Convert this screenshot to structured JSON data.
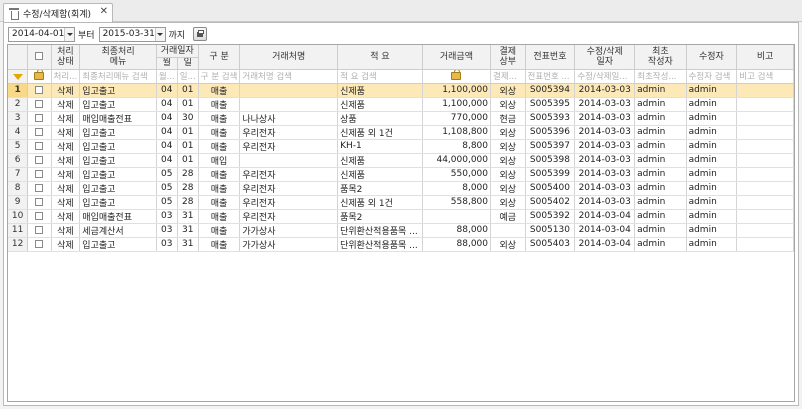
{
  "tab": {
    "title": "수정/삭제함(회계)",
    "close": "✕"
  },
  "toolbar": {
    "from_date": "2014-04-01",
    "from_label": "부터",
    "to_date": "2015-03-31",
    "to_label": "까지"
  },
  "headers": {
    "status": "처리\n상태",
    "menu": "최종처리\n메뉴",
    "trade_date": "거래일자",
    "month": "월",
    "day": "일",
    "category": "구 분",
    "customer": "거래처명",
    "summary": "적 요",
    "amount": "거래금액",
    "payment": "결제\n상부",
    "voucher": "전표번호",
    "modified_date": "수정/삭제\n일자",
    "creator": "최초\n작성자",
    "modifier": "수정자",
    "note": "비고"
  },
  "filters": {
    "status": "처리...",
    "menu": "최종처리메뉴 검색",
    "month": "월...",
    "day": "일...",
    "category": "구 분 검색",
    "customer": "거래처명 검색",
    "summary": "적 요 검색",
    "payment": "결제...",
    "voucher": "전표번호 ...",
    "modified_date": "수정/삭제일...",
    "creator": "최초작성...",
    "modifier": "수정자 검색",
    "note": "비고 검색"
  },
  "rows": [
    {
      "no": "1",
      "status": "삭제",
      "menu": "입고출고",
      "month": "04",
      "day": "01",
      "category": "매출",
      "customer": "",
      "summary": "신제품",
      "amount": "1,100,000",
      "payment": "외상",
      "voucher": "S005394",
      "modified": "2014-03-03",
      "creator": "admin",
      "modifier": "admin",
      "note": ""
    },
    {
      "no": "2",
      "status": "삭제",
      "menu": "입고출고",
      "month": "04",
      "day": "01",
      "category": "매출",
      "customer": "",
      "summary": "신제품",
      "amount": "1,100,000",
      "payment": "외상",
      "voucher": "S005395",
      "modified": "2014-03-03",
      "creator": "admin",
      "modifier": "admin",
      "note": ""
    },
    {
      "no": "3",
      "status": "삭제",
      "menu": "매입매출전표",
      "month": "04",
      "day": "30",
      "category": "매출",
      "customer": "나나상사",
      "summary": "상품",
      "amount": "770,000",
      "payment": "현금",
      "voucher": "S005393",
      "modified": "2014-03-03",
      "creator": "admin",
      "modifier": "admin",
      "note": ""
    },
    {
      "no": "4",
      "status": "삭제",
      "menu": "입고출고",
      "month": "04",
      "day": "01",
      "category": "매출",
      "customer": "우리전자",
      "summary": "신제품 외 1건",
      "amount": "1,108,800",
      "payment": "외상",
      "voucher": "S005396",
      "modified": "2014-03-03",
      "creator": "admin",
      "modifier": "admin",
      "note": ""
    },
    {
      "no": "5",
      "status": "삭제",
      "menu": "입고출고",
      "month": "04",
      "day": "01",
      "category": "매출",
      "customer": "우리전자",
      "summary": "KH-1",
      "amount": "8,800",
      "payment": "외상",
      "voucher": "S005397",
      "modified": "2014-03-03",
      "creator": "admin",
      "modifier": "admin",
      "note": ""
    },
    {
      "no": "6",
      "status": "삭제",
      "menu": "입고출고",
      "month": "04",
      "day": "01",
      "category": "매입",
      "customer": "",
      "summary": "신제품",
      "amount": "44,000,000",
      "payment": "외상",
      "voucher": "S005398",
      "modified": "2014-03-03",
      "creator": "admin",
      "modifier": "admin",
      "note": ""
    },
    {
      "no": "7",
      "status": "삭제",
      "menu": "입고출고",
      "month": "05",
      "day": "28",
      "category": "매출",
      "customer": "우리전자",
      "summary": "신제품",
      "amount": "550,000",
      "payment": "외상",
      "voucher": "S005399",
      "modified": "2014-03-03",
      "creator": "admin",
      "modifier": "admin",
      "note": ""
    },
    {
      "no": "8",
      "status": "삭제",
      "menu": "입고출고",
      "month": "05",
      "day": "28",
      "category": "매출",
      "customer": "우리전자",
      "summary": "품목2",
      "amount": "8,000",
      "payment": "외상",
      "voucher": "S005400",
      "modified": "2014-03-03",
      "creator": "admin",
      "modifier": "admin",
      "note": ""
    },
    {
      "no": "9",
      "status": "삭제",
      "menu": "입고출고",
      "month": "05",
      "day": "28",
      "category": "매출",
      "customer": "우리전자",
      "summary": "신제품 외 1건",
      "amount": "558,800",
      "payment": "외상",
      "voucher": "S005402",
      "modified": "2014-03-03",
      "creator": "admin",
      "modifier": "admin",
      "note": ""
    },
    {
      "no": "10",
      "status": "삭제",
      "menu": "매입매출전표",
      "month": "03",
      "day": "31",
      "category": "매출",
      "customer": "우리전자",
      "summary": "품목2",
      "amount": "",
      "payment": "예금",
      "voucher": "S005392",
      "modified": "2014-03-04",
      "creator": "admin",
      "modifier": "admin",
      "note": ""
    },
    {
      "no": "11",
      "status": "삭제",
      "menu": "세금계산서",
      "month": "03",
      "day": "31",
      "category": "매출",
      "customer": "가가상사",
      "summary": "단위환산적용품목 ...",
      "amount": "88,000",
      "payment": "",
      "voucher": "S005130",
      "modified": "2014-03-04",
      "creator": "admin",
      "modifier": "admin",
      "note": ""
    },
    {
      "no": "12",
      "status": "삭제",
      "menu": "입고출고",
      "month": "03",
      "day": "31",
      "category": "매출",
      "customer": "가가상사",
      "summary": "단위환산적용품목 ...",
      "amount": "88,000",
      "payment": "외상",
      "voucher": "S005403",
      "modified": "2014-03-04",
      "creator": "admin",
      "modifier": "admin",
      "note": ""
    }
  ]
}
